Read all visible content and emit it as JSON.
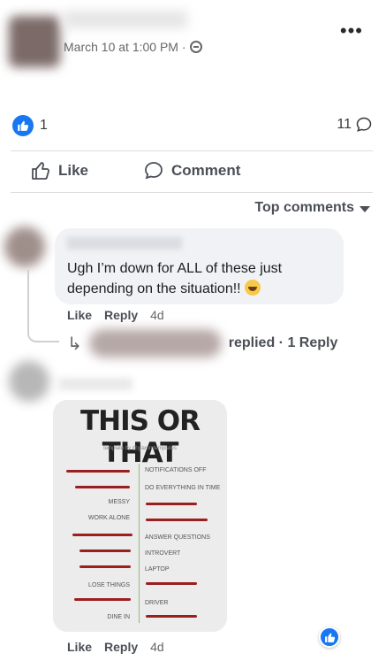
{
  "post": {
    "timestamp": "March 10 at 1:00 PM ·",
    "reaction_count": "1",
    "comment_count": "11"
  },
  "actions": {
    "like_label": "Like",
    "comment_label": "Comment"
  },
  "sort": {
    "label": "Top comments"
  },
  "comments": [
    {
      "text": "Ugh I’m down for ALL of these just depending on the situation!!",
      "like_label": "Like",
      "reply_label": "Reply",
      "time": "4d",
      "reply_summary": "replied · 1 Reply"
    },
    {
      "like_label": "Like",
      "reply_label": "Reply",
      "time": "4d",
      "image": {
        "title": "THIS OR THAT",
        "subtitle": "template by @glammtemplates",
        "left_items": [
          "MESSY",
          "WORK ALONE",
          "LOSE THINGS",
          "DINE IN"
        ],
        "right_items": [
          "NOTIFICATIONS OFF",
          "DO EVERYTHING IN TIME",
          "ANSWER QUESTIONS",
          "INTROVERT",
          "LAPTOP",
          "DRIVER"
        ]
      }
    }
  ],
  "colors": {
    "accent": "#1877f2",
    "strike": "#9a1f1f",
    "divider": "#8cbf7f"
  }
}
